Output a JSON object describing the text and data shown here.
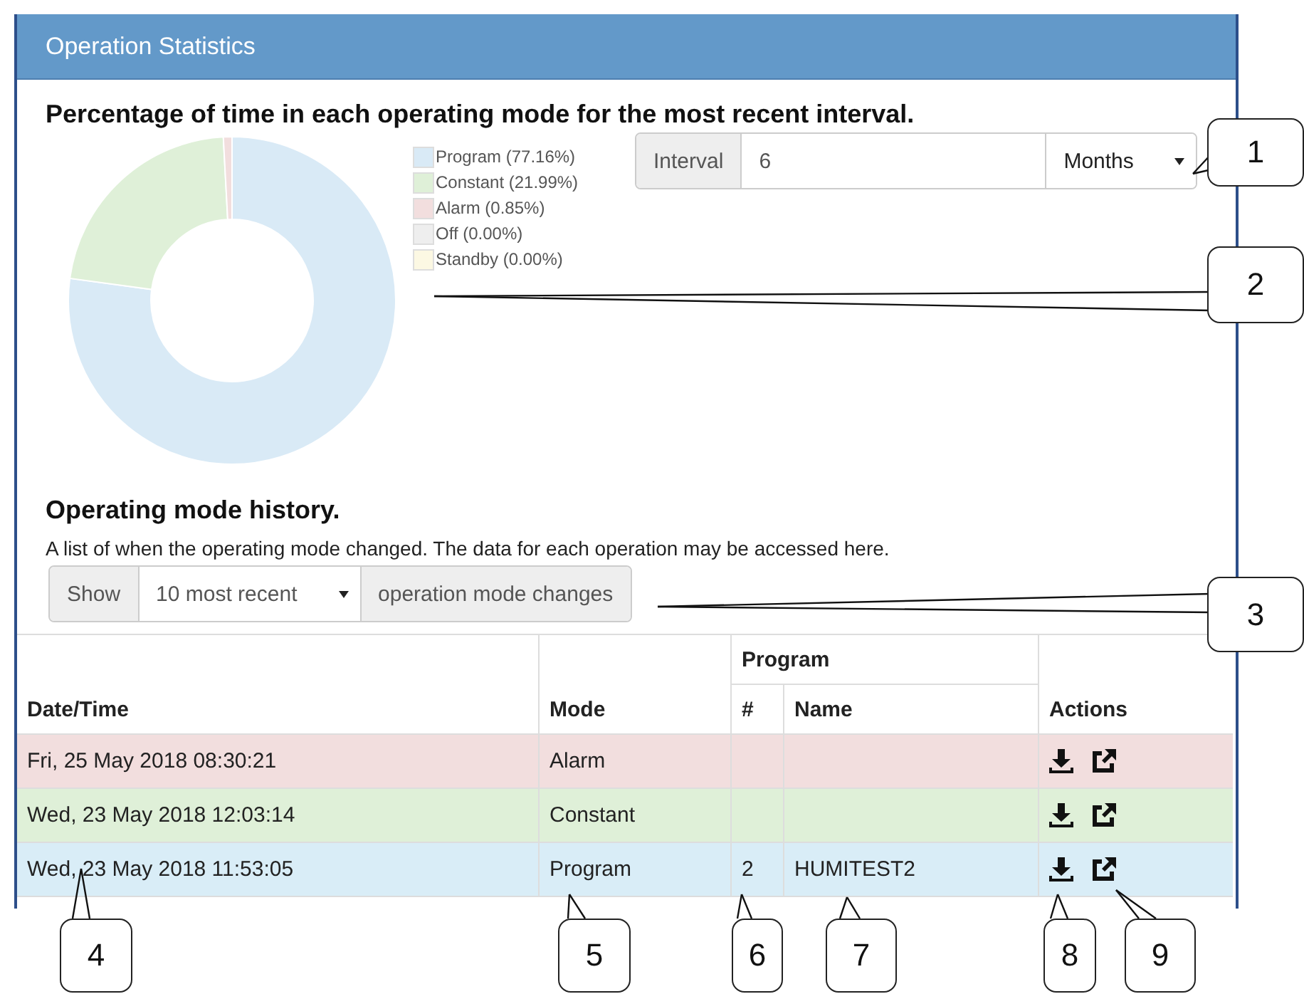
{
  "panel": {
    "title": "Operation Statistics"
  },
  "summary": {
    "heading": "Percentage of time in each operating mode for the most recent interval.",
    "legend": [
      {
        "percent": "(77.16%)",
        "color": "#d9eaf6"
      },
      {
        "percent": "(21.99%)",
        "color": "#dff0d8"
      },
      {
        "percent": "(0.85%)",
        "color": "#f2dede"
      },
      {
        "percent": "(0.00%)",
        "color": "#eeeeee"
      },
      {
        "percent": "(0.00%)",
        "color": "#fcf8e3"
      }
    ],
    "chart_data": {
      "type": "donut",
      "categories": [
        "Program",
        "Constant",
        "Alarm",
        "Off",
        "Standby"
      ],
      "values": [
        77.16,
        21.99,
        0.85,
        0,
        0
      ]
    },
    "interval": {
      "label": "Interval",
      "value": "6",
      "unit": "Months"
    }
  },
  "history": {
    "heading": "Operating mode history.",
    "description": "A list of when the operating mode changed. The data for each operation may be accessed here.",
    "show_label": "Show",
    "show_value": "10 most recent",
    "show_suffix": "operation mode changes"
  },
  "table": {
    "columns": [
      "Date/Time",
      "Mode",
      "Program",
      "#",
      "Name",
      "Actions"
    ],
    "rows": [
      {
        "date_time": "Fri, 25 May 2018 08:30:21",
        "mode": "Alarm",
        "color": "#f2dede"
      },
      {
        "date_time": "Wed, 23 May 2018 12:03:14",
        "mode": "Constant",
        "color": "#dff0d8"
      },
      {
        "date_time": "Wed, 23 May 2018 11:53:05",
        "mode": "Program",
        "number": "2",
        "name": "HUMITEST2",
        "color": "#d9edf7"
      }
    ]
  },
  "callouts": [
    {
      "label": "1"
    },
    {
      "label": "2"
    },
    {
      "label": "3"
    },
    {
      "label": "4"
    },
    {
      "label": "5"
    },
    {
      "label": "6"
    },
    {
      "label": "7"
    },
    {
      "label": "8"
    },
    {
      "label": "9"
    }
  ]
}
